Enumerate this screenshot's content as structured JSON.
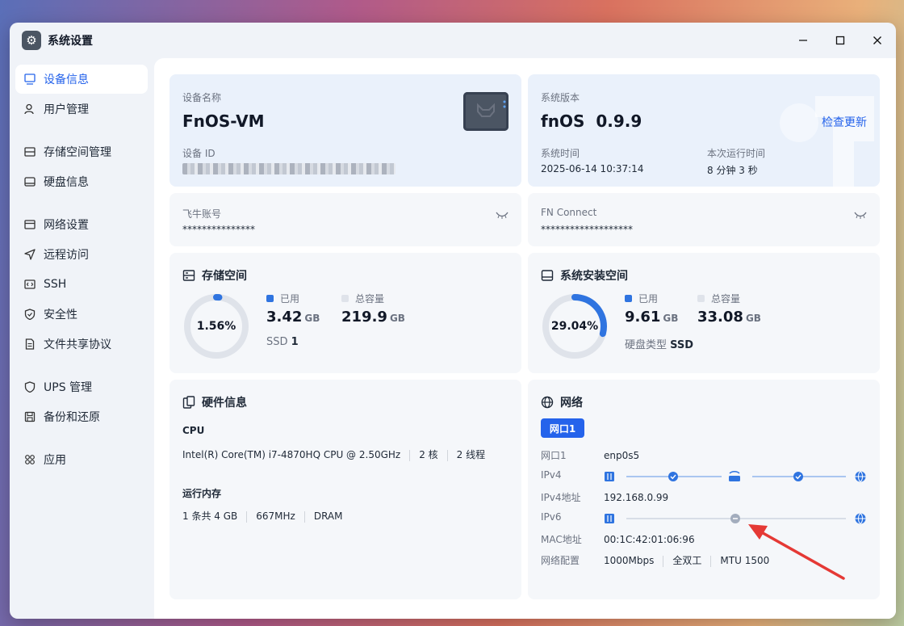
{
  "window": {
    "title": "系统设置"
  },
  "sidebar": {
    "items": [
      {
        "label": "设备信息"
      },
      {
        "label": "用户管理"
      },
      {
        "label": "存储空间管理"
      },
      {
        "label": "硬盘信息"
      },
      {
        "label": "网络设置"
      },
      {
        "label": "远程访问"
      },
      {
        "label": "SSH"
      },
      {
        "label": "安全性"
      },
      {
        "label": "文件共享协议"
      },
      {
        "label": "UPS 管理"
      },
      {
        "label": "备份和还原"
      },
      {
        "label": "应用"
      }
    ]
  },
  "device": {
    "name_label": "设备名称",
    "name": "FnOS-VM",
    "id_label": "设备 ID"
  },
  "system": {
    "version_label": "系统版本",
    "os_name": "fnOS",
    "version": "0.9.9",
    "check_update": "检查更新",
    "time_label": "系统时间",
    "time": "2025-06-14 10:37:14",
    "uptime_label": "本次运行时间",
    "uptime": "8 分钟 3 秒"
  },
  "account": {
    "label": "飞牛账号",
    "value": "***************"
  },
  "fnconnect": {
    "label": "FN Connect",
    "value": "*******************"
  },
  "storage": {
    "title": "存储空间",
    "percent_text": "1.56%",
    "percent": 1.56,
    "used_label": "已用",
    "used": "3.42",
    "used_unit": "GB",
    "total_label": "总容量",
    "total": "219.9",
    "total_unit": "GB",
    "ssd_label": "SSD",
    "ssd_count": "1"
  },
  "sysdisk": {
    "title": "系统安装空间",
    "percent_text": "29.04%",
    "percent": 29.04,
    "used_label": "已用",
    "used": "9.61",
    "used_unit": "GB",
    "total_label": "总容量",
    "total": "33.08",
    "total_unit": "GB",
    "disk_type_label": "硬盘类型",
    "disk_type": "SSD"
  },
  "hardware": {
    "title": "硬件信息",
    "cpu_label": "CPU",
    "cpu_model": "Intel(R) Core(TM) i7-4870HQ CPU @ 2.50GHz",
    "cpu_cores": "2 核",
    "cpu_threads": "2 线程",
    "mem_label": "运行内存",
    "mem_slots": "1 条共 4 GB",
    "mem_freq": "667MHz",
    "mem_type": "DRAM"
  },
  "network": {
    "title": "网络",
    "tab": "网口1",
    "port_label": "网口1",
    "port": "enp0s5",
    "ipv4_label": "IPv4",
    "ipv4_addr_label": "IPv4地址",
    "ipv4_addr": "192.168.0.99",
    "ipv6_label": "IPv6",
    "mac_label": "MAC地址",
    "mac": "00:1C:42:01:06:96",
    "config_label": "网络配置",
    "speed": "1000Mbps",
    "duplex": "全双工",
    "mtu": "MTU 1500"
  },
  "colors": {
    "accent": "#2563eb",
    "annotation": "#e53935"
  }
}
